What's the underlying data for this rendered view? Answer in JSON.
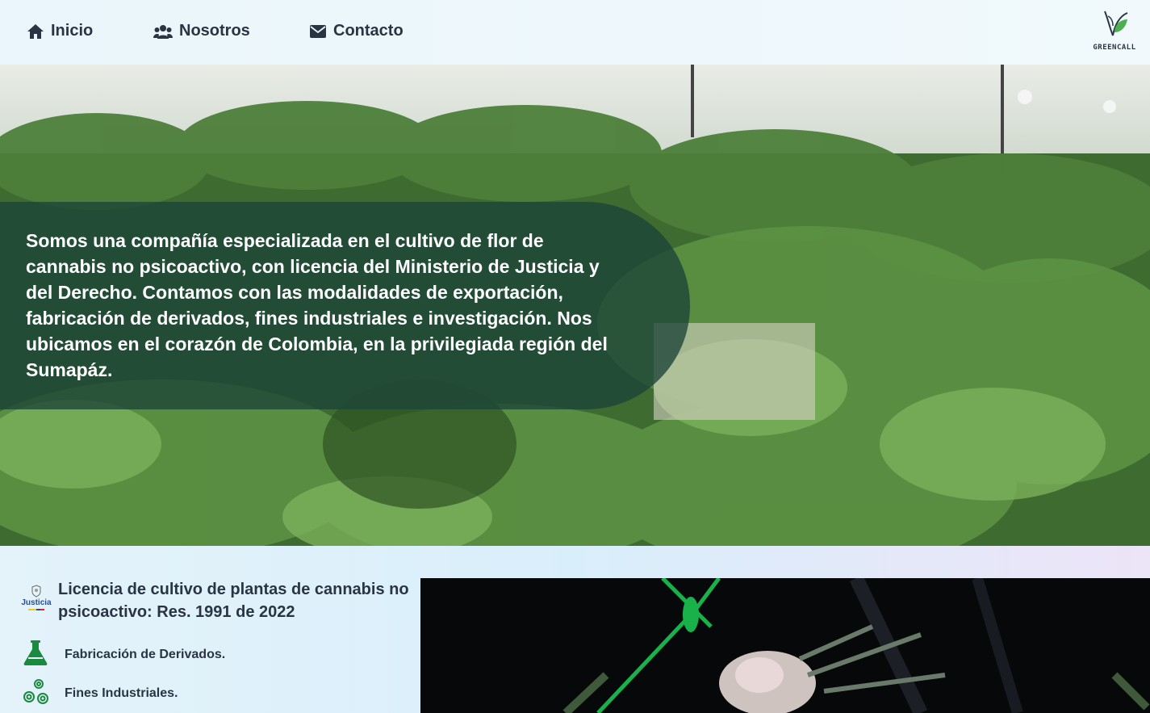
{
  "nav": {
    "items": [
      {
        "label": "Inicio",
        "icon": "home-icon"
      },
      {
        "label": "Nosotros",
        "icon": "users-icon"
      },
      {
        "label": "Contacto",
        "icon": "envelope-icon"
      }
    ],
    "logo_text": "GREENCALL"
  },
  "hero": {
    "text": "Somos una compañía especializada en el cultivo de flor de cannabis no psicoactivo, con licencia del Ministerio de Justicia y del Derecho. Contamos con las modalidades de exportación, fabricación de derivados, fines industriales e investigación. Nos ubicamos en el corazón de Colombia, en la privilegiada región del Sumapáz."
  },
  "license": {
    "logo_text": "Justicia",
    "text": "Licencia de cultivo de plantas de cannabis no psicoactivo: Res. 1991 de 2022"
  },
  "features": [
    {
      "label": "Fabricación de Derivados.",
      "icon": "flask-icon"
    },
    {
      "label": "Fines Industriales.",
      "icon": "gears-icon"
    }
  ],
  "colors": {
    "text_dark": "#2a3543",
    "accent_green": "#1a8a3f",
    "hero_overlay": "#1c4438"
  }
}
